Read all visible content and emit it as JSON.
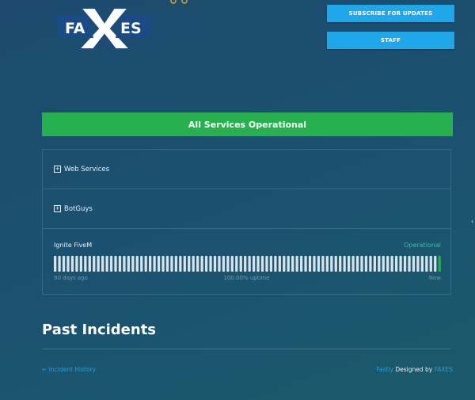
{
  "header": {
    "logo_text_left": "FA",
    "logo_text_right": "ES",
    "subscribe_label": "SUBSCRIBE FOR UPDATES",
    "staff_label": "STAFF"
  },
  "status_banner": {
    "text": "All Services Operational",
    "color": "#27b14e"
  },
  "components": {
    "groups": [
      {
        "name": "Web Services",
        "icon": "plus-square-icon"
      },
      {
        "name": "BotGuys",
        "icon": "plus-square-icon"
      }
    ],
    "fivem": {
      "name": "Ignite FiveM",
      "status": "Operational",
      "days_label": "90 days ago",
      "uptime_label": "100.00% uptime",
      "now_label": "Now",
      "bar_count": 90
    }
  },
  "past_incidents": {
    "title": "Past Incidents",
    "history_link": "← Incident History"
  },
  "footer": {
    "powered": "Fastly",
    "designed_by": "Designed by",
    "brand": "FAXES"
  },
  "colors": {
    "accent": "#1ea7ea",
    "operational": "#2fc4a0",
    "bar": "#d7e3ea",
    "bar_now": "#27b14e"
  }
}
